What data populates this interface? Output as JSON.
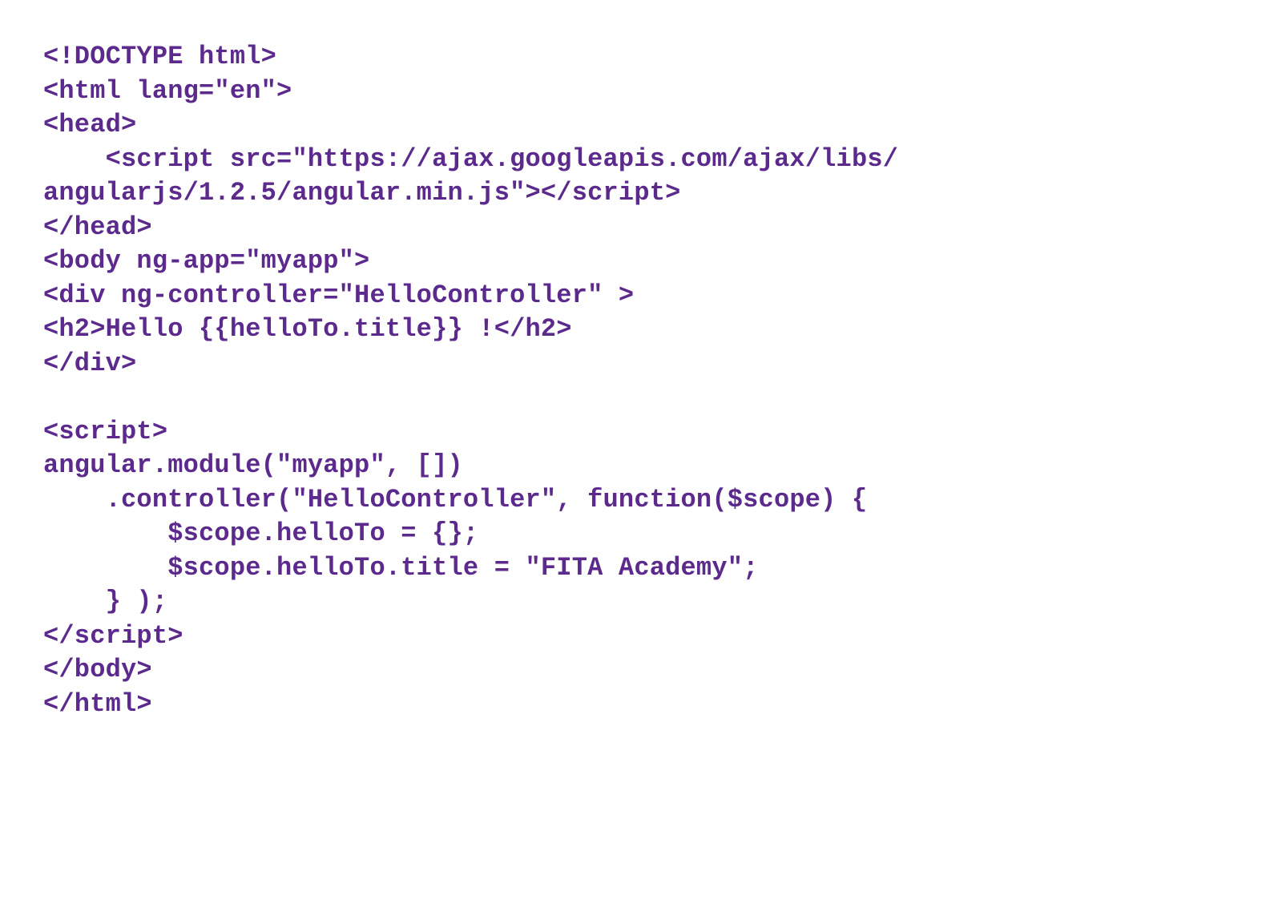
{
  "code": {
    "lines": [
      "<!DOCTYPE html>",
      "<html lang=\"en\">",
      "<head>",
      "    <script src=\"https://ajax.googleapis.com/ajax/libs/",
      "angularjs/1.2.5/angular.min.js\"></script>",
      "</head>",
      "<body ng-app=\"myapp\">",
      "<div ng-controller=\"HelloController\" >",
      "<h2>Hello {{helloTo.title}} !</h2>",
      "</div>",
      "",
      "<script>",
      "angular.module(\"myapp\", [])",
      "    .controller(\"HelloController\", function($scope) {",
      "        $scope.helloTo = {};",
      "        $scope.helloTo.title = \"FITA Academy\";",
      "    } );",
      "</script>",
      "</body>",
      "</html>"
    ]
  }
}
